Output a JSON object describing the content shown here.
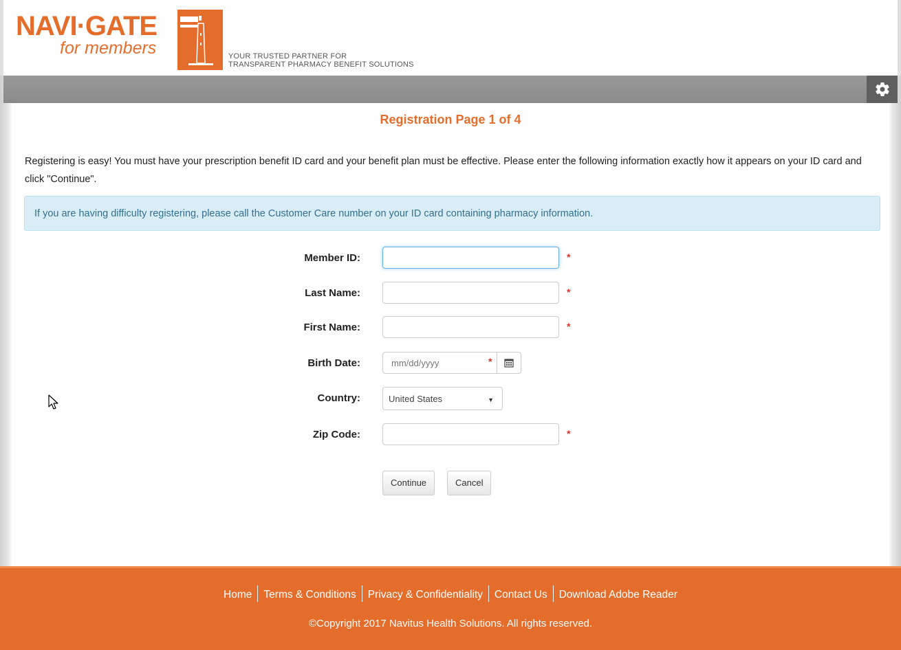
{
  "header": {
    "logo_main": "NAVI·GATE",
    "logo_sub": "for members",
    "tagline_line1": "YOUR TRUSTED PARTNER FOR",
    "tagline_line2": "TRANSPARENT PHARMACY BENEFIT SOLUTIONS",
    "settings_icon": "gear-icon"
  },
  "main": {
    "title": "Registration Page 1 of 4",
    "intro": "Registering is easy!  You must have your prescription benefit ID card and your benefit plan must be effective.  Please enter the following information exactly how it appears on your ID card and click \"Continue\".",
    "alert": "If you are having difficulty registering, please call the Customer Care number on your ID card containing pharmacy information."
  },
  "form": {
    "member_id": {
      "label": "Member ID:",
      "value": "",
      "required": "*"
    },
    "last_name": {
      "label": "Last Name:",
      "value": "",
      "required": "*"
    },
    "first_name": {
      "label": "First Name:",
      "value": "",
      "required": "*"
    },
    "birth_date": {
      "label": "Birth Date:",
      "placeholder": "mm/dd/yyyy",
      "required": "*",
      "icon": "calendar-icon"
    },
    "country": {
      "label": "Country:",
      "selected": "United States"
    },
    "zip_code": {
      "label": "Zip Code:",
      "value": "",
      "required": "*"
    },
    "continue_label": "Continue",
    "cancel_label": "Cancel"
  },
  "footer": {
    "links": [
      "Home",
      "Terms & Conditions",
      "Privacy & Confidentiality",
      "Contact Us",
      "Download Adobe Reader"
    ],
    "copyright": "©Copyright 2017 Navitus Health Solutions. All rights reserved."
  },
  "colors": {
    "brand_orange": "#e56d2c",
    "alert_bg": "#d9edf7",
    "alert_text": "#31708f",
    "required": "#d9342b"
  }
}
